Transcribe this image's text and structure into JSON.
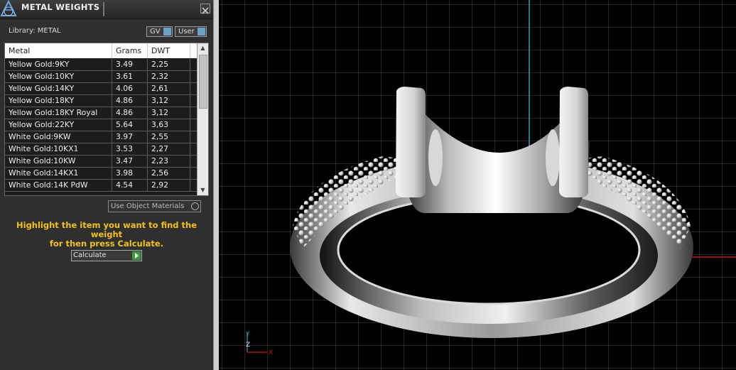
{
  "panel": {
    "title": "METAL WEIGHTS",
    "library_label": "Library: METAL",
    "gv_label": "GV",
    "user_label": "User",
    "columns": [
      "Metal",
      "Grams",
      "DWT"
    ],
    "rows": [
      {
        "metal": "Yellow Gold:9KY",
        "grams": "3.49",
        "dwt": "2,25"
      },
      {
        "metal": "Yellow Gold:10KY",
        "grams": "3.61",
        "dwt": "2,32"
      },
      {
        "metal": "Yellow Gold:14KY",
        "grams": "4.06",
        "dwt": "2,61"
      },
      {
        "metal": "Yellow Gold:18KY",
        "grams": "4.86",
        "dwt": "3,12"
      },
      {
        "metal": "Yellow Gold:18KY Royal",
        "grams": "4.86",
        "dwt": "3,12"
      },
      {
        "metal": "Yellow Gold:22KY",
        "grams": "5.64",
        "dwt": "3,63"
      },
      {
        "metal": "White Gold:9KW",
        "grams": "3.97",
        "dwt": "2,55"
      },
      {
        "metal": "White Gold:10KX1",
        "grams": "3.53",
        "dwt": "2,27"
      },
      {
        "metal": "White Gold:10KW",
        "grams": "3.47",
        "dwt": "2,23"
      },
      {
        "metal": "White Gold:14KX1",
        "grams": "3.98",
        "dwt": "2,56"
      },
      {
        "metal": "White Gold:14K PdW",
        "grams": "4.54",
        "dwt": "2,92"
      }
    ],
    "use_object_materials_label": "Use Object Materials",
    "hint_line1": "Highlight the item you want to find the weight",
    "hint_line2": "for then press Calculate.",
    "calculate_label": "Calculate"
  },
  "viewport": {
    "axis_z_label": "Z",
    "axis_x_label": "X",
    "axis_y_label": "Y",
    "colors": {
      "grid": "#4a4a4a",
      "y_axis": "#29a8b8",
      "x_axis": "#c0201a",
      "background": "#000000"
    }
  }
}
